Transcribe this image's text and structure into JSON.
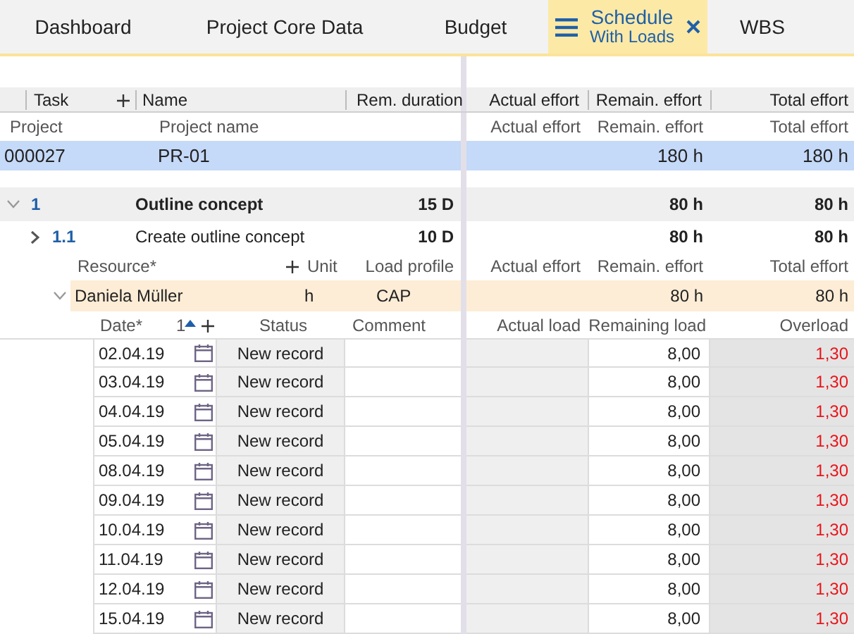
{
  "tabs": [
    {
      "label": "Dashboard",
      "selected": false
    },
    {
      "label": "Project Core Data",
      "selected": false
    },
    {
      "label": "Budget",
      "selected": false
    },
    {
      "label": "Schedule",
      "sublabel": "With Loads",
      "selected": true
    },
    {
      "label": "WBS",
      "selected": false
    }
  ],
  "columns": {
    "left": [
      "Task",
      "Name",
      "Rem. duration"
    ],
    "right": [
      "Actual effort",
      "Remain. effort",
      "Total effort"
    ]
  },
  "project": {
    "labels": {
      "project": "Project",
      "name": "Project name",
      "actual": "Actual effort",
      "remain": "Remain. effort",
      "total": "Total effort"
    },
    "row": {
      "id": "000027",
      "name": "PR-01",
      "remain": "180 h",
      "total": "180 h",
      "selected": true
    }
  },
  "tasks": [
    {
      "number": "1",
      "name": "Outline concept",
      "duration": "15 D",
      "remain": "80 h",
      "total": "80 h",
      "expanded": true,
      "children": [
        {
          "number": "1.1",
          "name": "Create outline concept",
          "duration": "10 D",
          "remain": "80 h",
          "total": "80 h",
          "expanded": false
        }
      ]
    }
  ],
  "resources": {
    "header": {
      "resource": "Resource*",
      "unit": "Unit",
      "load_profile": "Load profile",
      "actual": "Actual effort",
      "remain": "Remain. effort",
      "total": "Total effort"
    },
    "rows": [
      {
        "name": "Daniela Müller",
        "unit": "h",
        "load_profile": "CAP",
        "remain": "80 h",
        "total": "80 h",
        "expanded": true
      }
    ]
  },
  "loads": {
    "header": {
      "date": "Date*",
      "sort": "1",
      "status": "Status",
      "comment": "Comment",
      "actual_load": "Actual load",
      "remaining_load": "Remaining load",
      "overload": "Overload"
    },
    "rows": [
      {
        "date": "02.04.19",
        "status": "New record",
        "remaining_load": "8,00",
        "overload": "1,30"
      },
      {
        "date": "03.04.19",
        "status": "New record",
        "remaining_load": "8,00",
        "overload": "1,30"
      },
      {
        "date": "04.04.19",
        "status": "New record",
        "remaining_load": "8,00",
        "overload": "1,30"
      },
      {
        "date": "05.04.19",
        "status": "New record",
        "remaining_load": "8,00",
        "overload": "1,30"
      },
      {
        "date": "08.04.19",
        "status": "New record",
        "remaining_load": "8,00",
        "overload": "1,30"
      },
      {
        "date": "09.04.19",
        "status": "New record",
        "remaining_load": "8,00",
        "overload": "1,30"
      },
      {
        "date": "10.04.19",
        "status": "New record",
        "remaining_load": "8,00",
        "overload": "1,30"
      },
      {
        "date": "11.04.19",
        "status": "New record",
        "remaining_load": "8,00",
        "overload": "1,30"
      },
      {
        "date": "12.04.19",
        "status": "New record",
        "remaining_load": "8,00",
        "overload": "1,30"
      },
      {
        "date": "15.04.19",
        "status": "New record",
        "remaining_load": "8,00",
        "overload": "1,30"
      }
    ]
  }
}
